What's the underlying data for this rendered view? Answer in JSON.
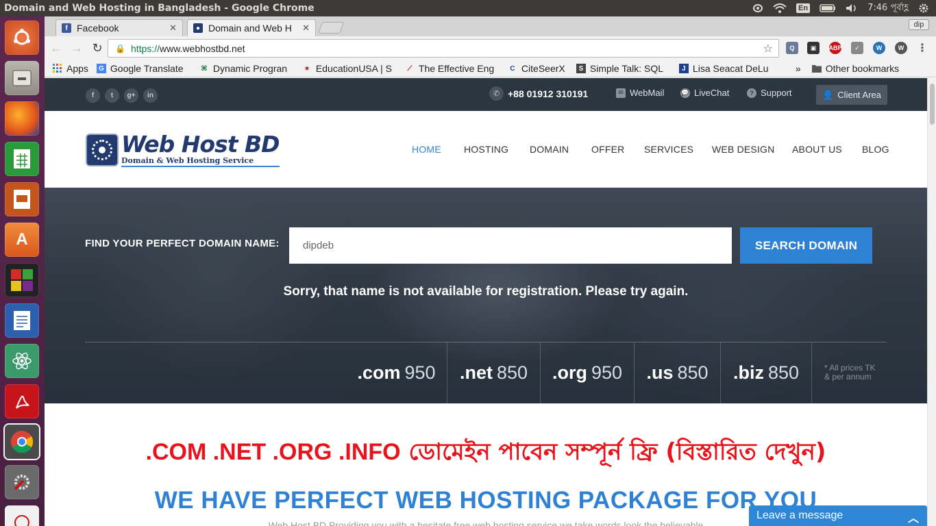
{
  "os": {
    "window_title": "Domain and Web Hosting in Bangladesh - Google Chrome",
    "keyboard": "En",
    "time": "7:46 পূর্বাহ্ণ"
  },
  "browser": {
    "tabs": [
      {
        "label": "Facebook",
        "icon": "facebook-icon"
      },
      {
        "label": "Domain and Web H",
        "icon": "webhostbd-icon"
      }
    ],
    "profile": "dip",
    "url_scheme": "https://",
    "url_host": "www.webhostbd.net",
    "bookmarks": [
      {
        "label": "Apps"
      },
      {
        "label": "Google Translate"
      },
      {
        "label": "Dynamic Progran"
      },
      {
        "label": "EducationUSA | S"
      },
      {
        "label": "The Effective Eng"
      },
      {
        "label": "CiteSeerX"
      },
      {
        "label": "Simple Talk: SQL"
      },
      {
        "label": "Lisa Seacat DeLu"
      }
    ],
    "overflow": "»",
    "other_bookmarks": "Other bookmarks"
  },
  "site": {
    "topbar": {
      "phone": "+88 01912 310191",
      "webmail": "WebMail",
      "livechat": "LiveChat",
      "support": "Support",
      "client_area": "Client Area"
    },
    "logo": {
      "name": "Web Host BD",
      "tagline": "Domain & Web Hosting Service"
    },
    "nav": [
      "HOME",
      "HOSTING",
      "DOMAIN",
      "OFFER",
      "SERVICES",
      "WEB DESIGN",
      "ABOUT US",
      "BLOG"
    ],
    "search": {
      "label": "FIND YOUR PERFECT DOMAIN NAME:",
      "value": "dipdeb",
      "button": "SEARCH DOMAIN",
      "message": "Sorry, that name is not available for registration. Please try again."
    },
    "prices": [
      {
        "tld": ".com",
        "price": "950"
      },
      {
        "tld": ".net",
        "price": "850"
      },
      {
        "tld": ".org",
        "price": "950"
      },
      {
        "tld": ".us",
        "price": "850"
      },
      {
        "tld": ".biz",
        "price": "850"
      }
    ],
    "price_note_1": "* All prices TK",
    "price_note_2": "& per annum",
    "promo_latin": ".COM .NET .ORG .INFO",
    "promo_bangla": "ডোমেইন পাবেন সম্পূর্ন ফ্রি (বিস্তারিত দেখুন)",
    "headline": "WE HAVE PERFECT WEB HOSTING PACKAGE FOR YOU",
    "subtext": "Web Host BD Providing you with a hesitate free web hosting service we take words look the believable",
    "chat": "Leave a message"
  },
  "colors": {
    "accent": "#2f82d3",
    "promo_red": "#e8141d",
    "topbar": "#2b3640"
  }
}
